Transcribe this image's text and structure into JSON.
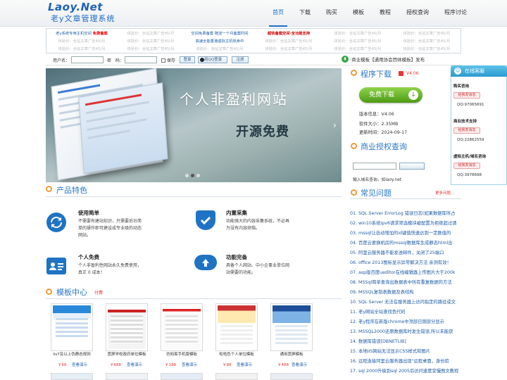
{
  "header": {
    "logo_en": "Laoy.Net",
    "logo_cn": "老y文章管理系统",
    "nav": [
      "首页",
      "下载",
      "购买",
      "模板",
      "教程",
      "授权查询",
      "程序讨论"
    ]
  },
  "ads": {
    "row1": [
      "老y系统专用主机空间",
      "免费备案",
      "体验价：全站文章广告45/月",
      "空间免费备案·赠送一个月备案时间",
      "超快备案空间·全功能支持",
      "体验价：全站文章广告45/月",
      "体验价：全站文章广告45/月"
    ],
    "row2": [
      "体验价：全站文章广告45/月",
      "体验价：全站文章广告45/月",
      "高速全能香港虚拟主机热卖中",
      "体验价：全站文章广告45/月",
      "体验价：全站文章广告45/月",
      "体验价：全站文章广告45/月"
    ],
    "row3": [
      "体验价：全站文章广告45/月",
      "体验价：全站文章广告45/月",
      "体验价：全站文章广告45/月",
      "体验价：全站文章广告45/月",
      "体验价：全站文章广告45/月",
      "体验价：全站文章广告45/月"
    ]
  },
  "login": {
    "user_label": "用户名：",
    "pass_label": "密　码：",
    "save_label": "保存",
    "login_btn": "登录",
    "qq_btn": "用QQ登录",
    "register_btn": "注册"
  },
  "notice": "·商业模板【通用协会团体模板】发布",
  "slider": {
    "title": "个人非盈利网站",
    "subtitle": "开源免费"
  },
  "features": {
    "title": "产品特色",
    "items": [
      {
        "title": "使用简单",
        "desc": "不需要有建站知识，只需要后台简单的操作即可建设成专业级的动态网站。"
      },
      {
        "title": "内置采集",
        "desc": "功能强大的内容采集系统，不必再为没有内容烦恼。"
      },
      {
        "title": "个人免费",
        "desc": "个人非盈利性网站永久免费使用，真正 0 成本！"
      },
      {
        "title": "功能完备",
        "desc": "具备个人网站、中小企事业单位网站需要的功能。"
      }
    ]
  },
  "templates": {
    "title": "模板中心",
    "tag": "付费",
    "demo_label": "查看演示",
    "items": [
      {
        "name": "lis7及以上伪静态规则",
        "price": "￥66"
      },
      {
        "name": "宽屏学校政府单位模板",
        "price": "￥688"
      },
      {
        "name": "仿网易手机版模板",
        "price": "￥188"
      },
      {
        "name": "啦啦色个人单位模板",
        "price": "￥88"
      },
      {
        "name": "通用宽屏模板",
        "price": "￥488"
      }
    ]
  },
  "download": {
    "title": "程序下载",
    "version_tag": "V4.06",
    "btn": "免费下载",
    "info": [
      "版本信息：V4.06",
      "软件大小：2.35MB",
      "更新时间：2024-09-17"
    ]
  },
  "license": {
    "title": "商业授权查询",
    "hint": "输入域名查询，如laoy.net"
  },
  "faq": {
    "title": "常见问题",
    "more": "更多问题...",
    "items": [
      "01. SQL Server ErrorLog 错误日志(如果数据库所占",
      "02. win10系统ipv6请求筛选模块被配置为拒绝超过请",
      "03. mssql让自动增加的id键值快速达到一定数值的",
      "04. 百度云要换机房的mssql数据库生成静态html出",
      "05. 阿里云服务器不能发送邮件，关闭了25端口",
      "06. office 2013图标显示异常解决方法 亲测有效！",
      "07. asp版百度ueditor在线编辑器上传图片大于200k",
      "08. MSSql简单查询出数据表中所有重复数据的方法",
      "09. MSSQL复制表数据及表结构",
      "10. SQL Server 无法在服务器上访问指定的路径或文",
      "11. 老y网站全站查找色代码",
      "12. 老y程序在新版chrome中顶部日期部分显示",
      "13. MSSQL2000还原数据库时发生错误,所以未能获",
      "14. 数据库错误[DBNETLIB]",
      "15. 本地IIS网站无法显示CSS样式和图片",
      "16. 远程连接阿里云服务器出现\"远程桌面，身份验",
      "17. sql 2000升级到sql 2005后访问速度变慢图文教程"
    ]
  },
  "service": {
    "title": "在线客服",
    "groups": [
      {
        "label": "购买咨询",
        "btn": "给我发消息",
        "qq": "QQ:97065691"
      },
      {
        "label": "商业技术支持",
        "btn": "给我发消息",
        "qq": "QQ:22862559"
      },
      {
        "label": "虚拟主机/域名咨询",
        "btn": "给我发消息",
        "qq": "QQ:3978698"
      }
    ]
  },
  "colors": {
    "accent": "#1f73c4",
    "download_green": "#59a81f",
    "price_red": "#e33"
  }
}
